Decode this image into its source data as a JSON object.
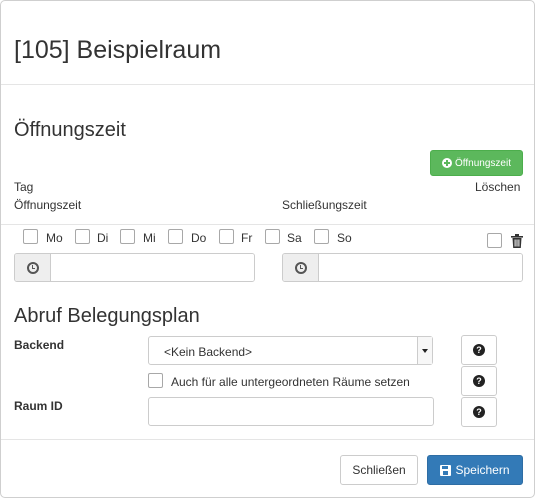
{
  "modal": {
    "title": "[105] Beispielraum"
  },
  "opening_hours": {
    "heading": "Öffnungszeit",
    "add_button_label": "Öffnungszeit",
    "col_day": "Tag",
    "col_delete": "Löschen",
    "col_open": "Öffnungszeit",
    "col_close": "Schließungszeit",
    "days": [
      "Mo",
      "Di",
      "Mi",
      "Do",
      "Fr",
      "Sa",
      "So"
    ],
    "open_time_value": "",
    "close_time_value": ""
  },
  "schedule": {
    "heading": "Abruf Belegungsplan",
    "backend_label": "Backend",
    "backend_selected": "<Kein Backend>",
    "apply_all_label": "Auch für alle untergeordneten Räume setzen",
    "room_id_label": "Raum ID",
    "room_id_value": ""
  },
  "footer": {
    "close_label": "Schließen",
    "save_label": "Speichern"
  },
  "colors": {
    "success": "#5cb85c",
    "primary": "#337ab7",
    "border": "#cccccc"
  },
  "icons": [
    "plus-circle-icon",
    "clock-icon",
    "trash-icon",
    "question-circle-icon",
    "save-icon",
    "chevron-down-icon"
  ]
}
